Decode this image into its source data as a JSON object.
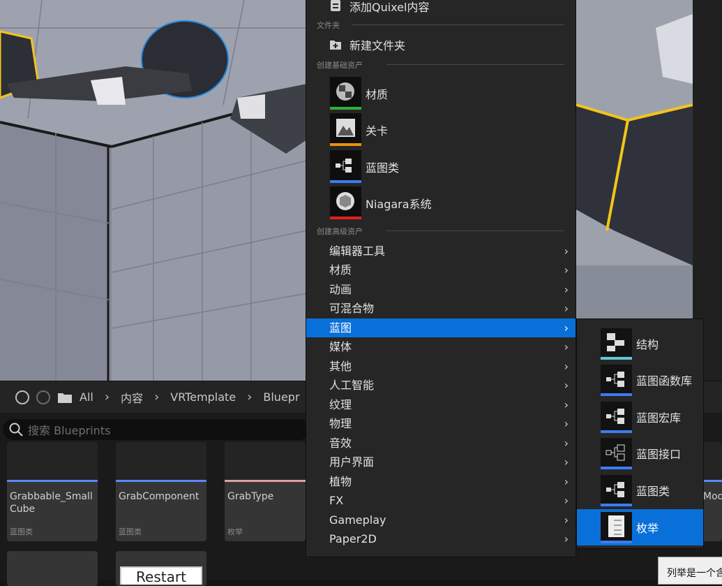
{
  "menu": {
    "top_item": "添加Quixel内容",
    "section_folder": "文件夹",
    "new_folder": "新建文件夹",
    "section_basic": "创建基础资产",
    "basic_items": [
      {
        "label": "材质",
        "icon": "material-icon",
        "color": "#2fb039"
      },
      {
        "label": "关卡",
        "icon": "level-icon",
        "color": "#e8920c"
      },
      {
        "label": "蓝图类",
        "icon": "blueprint-class-icon",
        "color": "#3b7cf0"
      },
      {
        "label": "Niagara系统",
        "icon": "niagara-icon",
        "color": "#e01f1f"
      }
    ],
    "section_advanced": "创建高级资产",
    "advanced_items": [
      "编辑器工具",
      "材质",
      "动画",
      "可混合物",
      "蓝图",
      "媒体",
      "其他",
      "人工智能",
      "纹理",
      "物理",
      "音效",
      "用户界面",
      "植物",
      "FX",
      "Gameplay",
      "Paper2D"
    ],
    "selected": "蓝图"
  },
  "submenu": {
    "items": [
      {
        "label": "结构",
        "icon": "struct-icon",
        "color": "#5fc8d8"
      },
      {
        "label": "蓝图函数库",
        "icon": "function-library-icon",
        "color": "#3b7cf0"
      },
      {
        "label": "蓝图宏库",
        "icon": "macro-library-icon",
        "color": "#3b7cf0"
      },
      {
        "label": "蓝图接口",
        "icon": "interface-icon",
        "color": "#3b7cf0"
      },
      {
        "label": "蓝图类",
        "icon": "blueprint-class-icon",
        "color": "#3b7cf0"
      },
      {
        "label": "枚举",
        "icon": "enum-icon",
        "color": "#3b7cf0"
      }
    ],
    "selected": "枚举"
  },
  "browser": {
    "path": [
      "All",
      "内容",
      "VRTemplate",
      "Bluepr"
    ],
    "search_placeholder": "搜索 Blueprints",
    "tiles": [
      {
        "name": "Grabbable_Small Cube",
        "type": "蓝图类"
      },
      {
        "name": "GrabComponent",
        "type": "蓝图类"
      },
      {
        "name": "GrabType",
        "type": "枚举"
      }
    ],
    "partial_tile": "Mod",
    "restart": "Restart"
  },
  "tooltip": "列举是一个含"
}
